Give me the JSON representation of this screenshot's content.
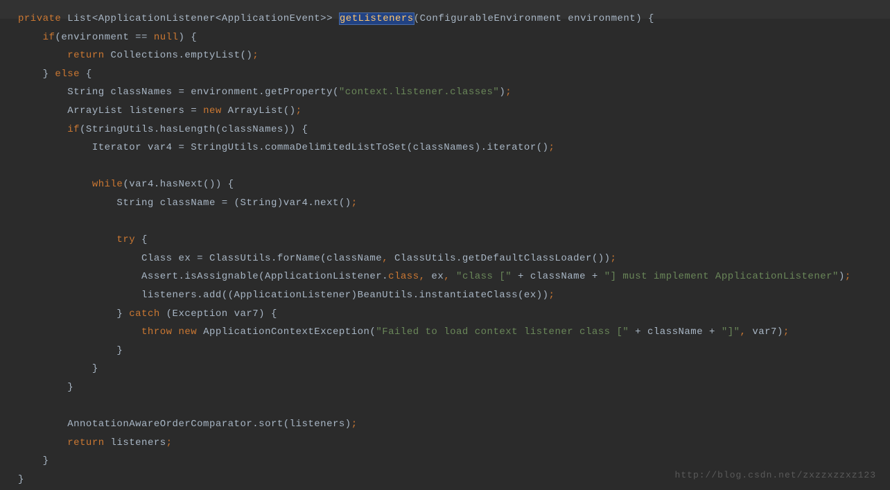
{
  "code": {
    "line1": {
      "kw_private": "private",
      "type_list": "List<ApplicationListener<ApplicationEvent>>",
      "method_name": "getListeners",
      "param_type": "ConfigurableEnvironment",
      "param_name": "environment",
      "brace": "{"
    },
    "line2": {
      "kw_if": "if",
      "expr": "(environment == ",
      "kw_null": "null",
      "close": ") {"
    },
    "line3": {
      "kw_return": "return",
      "expr": " Collections.emptyList()",
      "semi": ";"
    },
    "line4": {
      "close_brace": "} ",
      "kw_else": "else",
      "open": " {"
    },
    "line5": {
      "expr1": "String classNames = environment.getProperty(",
      "str": "\"context.listener.classes\"",
      "close": ")",
      "semi": ";"
    },
    "line6": {
      "expr1": "ArrayList listeners = ",
      "kw_new": "new",
      "expr2": " ArrayList()",
      "semi": ";"
    },
    "line7": {
      "kw_if": "if",
      "expr": "(StringUtils.hasLength(classNames)) {"
    },
    "line8": {
      "expr": "Iterator var4 = StringUtils.commaDelimitedListToSet(classNames).iterator()",
      "semi": ";"
    },
    "line9": {
      "kw_while": "while",
      "expr": "(var4.hasNext()) {"
    },
    "line10": {
      "expr": "String className = (String)var4.next()",
      "semi": ";"
    },
    "line11": {
      "kw_try": "try",
      "brace": " {"
    },
    "line12": {
      "expr1": "Class ex = ClassUtils.forName(className",
      "comma": ",",
      "expr2": " ClassUtils.getDefaultClassLoader())",
      "semi": ";"
    },
    "line13": {
      "expr1": "Assert.isAssignable(ApplicationListener.",
      "kw_class": "class",
      "comma1": ",",
      "expr2": " ex",
      "comma2": ",",
      "str1": " \"class [\"",
      "plus1": " + className + ",
      "str2": "\"] must implement ApplicationListener\"",
      "close": ")",
      "semi": ";"
    },
    "line14": {
      "expr": "listeners.add((ApplicationListener)BeanUtils.instantiateClass(ex))",
      "semi": ";"
    },
    "line15": {
      "close": "} ",
      "kw_catch": "catch",
      "expr": " (Exception var7) {"
    },
    "line16": {
      "kw_throw": "throw",
      "sp": " ",
      "kw_new": "new",
      "expr1": " ApplicationContextException(",
      "str1": "\"Failed to load context listener class [\"",
      "plus1": " + className + ",
      "str2": "\"]\"",
      "comma": ",",
      "expr2": " var7)",
      "semi": ";"
    },
    "line17": {
      "brace": "}"
    },
    "line18": {
      "brace": "}"
    },
    "line19": {
      "brace": "}"
    },
    "line20": {
      "expr": "AnnotationAwareOrderComparator.sort(listeners)",
      "semi": ";"
    },
    "line21": {
      "kw_return": "return",
      "expr": " listeners",
      "semi": ";"
    },
    "line22": {
      "brace": "}"
    },
    "line23": {
      "brace": "}"
    }
  },
  "watermark": "http://blog.csdn.net/zxzzxzzxz123"
}
